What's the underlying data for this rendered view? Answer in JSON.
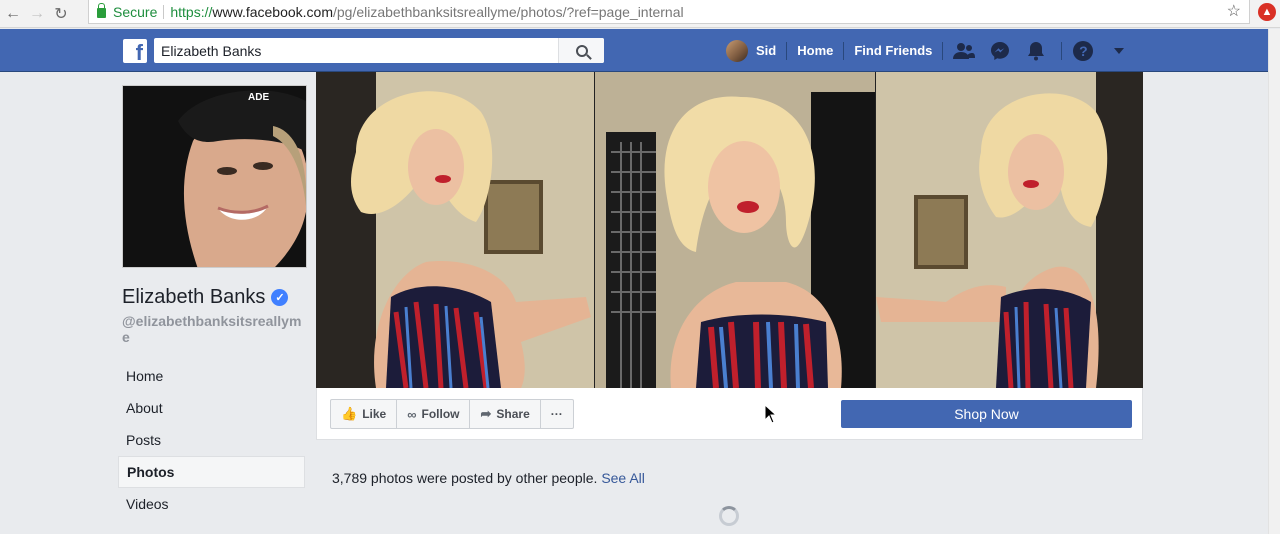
{
  "browser": {
    "secure_label": "Secure",
    "url_scheme": "https://",
    "url_host": "www.facebook.com",
    "url_path": "/pg/elizabethbanksitsreallyme/photos/?ref=page_internal",
    "back_icon": "arrow-left-icon",
    "forward_icon": "arrow-right-icon",
    "reload_icon": "reload-icon",
    "bookmark_icon": "star-icon"
  },
  "topbar": {
    "logo_letter": "f",
    "search_value": "Elizabeth Banks",
    "user_name": "Sid",
    "home_label": "Home",
    "find_friends_label": "Find Friends",
    "help_glyph": "?"
  },
  "profile": {
    "name": "Elizabeth Banks",
    "handle": "@elizabethbanksitsreallyme",
    "verified_glyph": "✓"
  },
  "sidenav": {
    "items": [
      {
        "label": "Home"
      },
      {
        "label": "About"
      },
      {
        "label": "Posts"
      },
      {
        "label": "Photos"
      },
      {
        "label": "Videos"
      }
    ],
    "active_index": 3
  },
  "actions": {
    "like_label": "Like",
    "follow_label": "Follow",
    "share_label": "Share",
    "more_label": "···",
    "shop_now_label": "Shop Now"
  },
  "photos": {
    "count_text": "3,789 photos were posted by other people.",
    "see_all_label": "See All"
  },
  "colors": {
    "fb_blue": "#4267b2",
    "link_blue": "#365899",
    "secure_green": "#1e8e3e"
  }
}
